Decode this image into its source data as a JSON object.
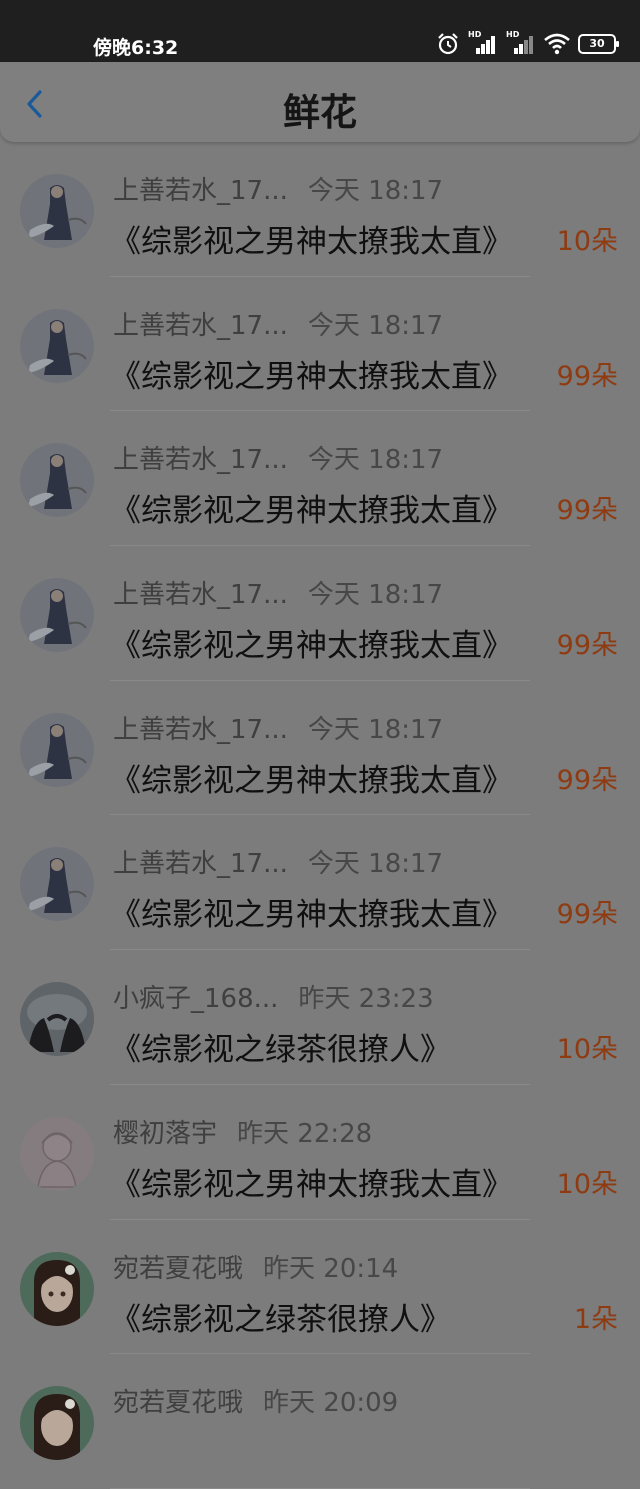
{
  "status_bar": {
    "time": "傍晚6:32",
    "network_label_1": "HD",
    "network_label_2": "HD",
    "battery": "30"
  },
  "header": {
    "title": "鲜花"
  },
  "rows": [
    {
      "user": "上善若水_17...",
      "time": "今天 18:17",
      "book": "《综影视之男神太撩我太直》",
      "count": "10朵",
      "avatar": "avatar-a"
    },
    {
      "user": "上善若水_17...",
      "time": "今天 18:17",
      "book": "《综影视之男神太撩我太直》",
      "count": "99朵",
      "avatar": "avatar-a"
    },
    {
      "user": "上善若水_17...",
      "time": "今天 18:17",
      "book": "《综影视之男神太撩我太直》",
      "count": "99朵",
      "avatar": "avatar-a"
    },
    {
      "user": "上善若水_17...",
      "time": "今天 18:17",
      "book": "《综影视之男神太撩我太直》",
      "count": "99朵",
      "avatar": "avatar-a"
    },
    {
      "user": "上善若水_17...",
      "time": "今天 18:17",
      "book": "《综影视之男神太撩我太直》",
      "count": "99朵",
      "avatar": "avatar-a"
    },
    {
      "user": "上善若水_17...",
      "time": "今天 18:17",
      "book": "《综影视之男神太撩我太直》",
      "count": "99朵",
      "avatar": "avatar-a"
    },
    {
      "user": "小疯子_168...",
      "time": "昨天 23:23",
      "book": "《综影视之绿茶很撩人》",
      "count": "10朵",
      "avatar": "avatar-b"
    },
    {
      "user": "樱初落宇",
      "time": "昨天 22:28",
      "book": "《综影视之男神太撩我太直》",
      "count": "10朵",
      "avatar": "avatar-c"
    },
    {
      "user": "宛若夏花哦",
      "time": "昨天 20:14",
      "book": "《综影视之绿茶很撩人》",
      "count": "1朵",
      "avatar": "avatar-d"
    },
    {
      "user": "宛若夏花哦",
      "time": "昨天 20:09",
      "book": "",
      "count": "",
      "avatar": "avatar-d"
    }
  ],
  "colors": {
    "count_text": "#8e3b12",
    "back_arrow": "#1a5a9a"
  }
}
